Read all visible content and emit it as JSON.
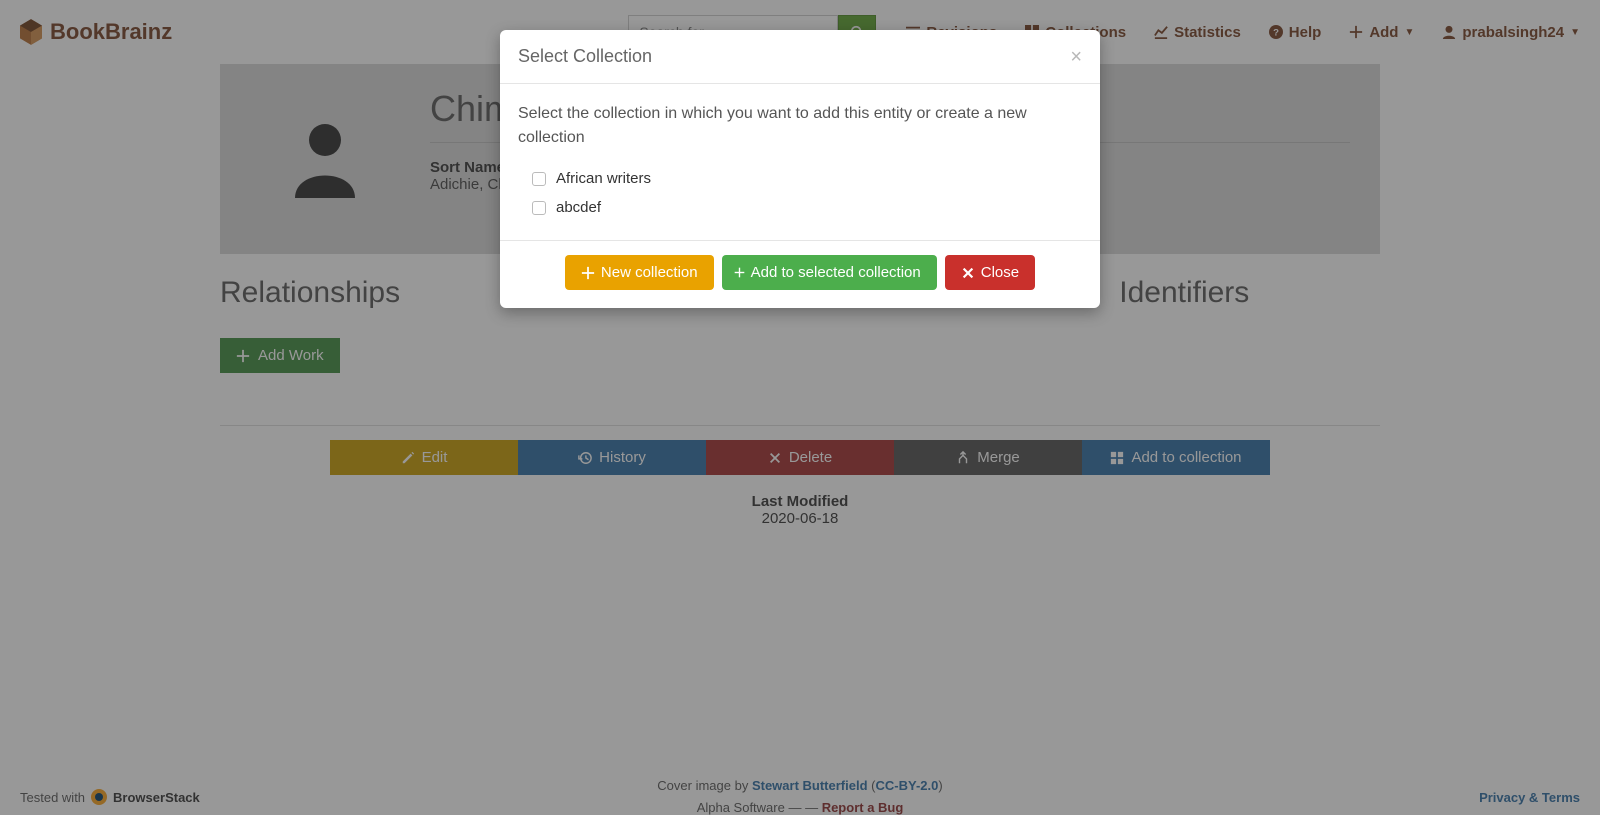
{
  "brand": "BookBrainz",
  "search": {
    "placeholder": "Search for..."
  },
  "nav": {
    "revisions": "Revisions",
    "collections": "Collections",
    "statistics": "Statistics",
    "help": "Help",
    "add": "Add",
    "user": "prabalsingh24"
  },
  "hero": {
    "title": "Chim",
    "sort_label": "Sort Name",
    "sort_value": "Adichie, Ch"
  },
  "sections": {
    "relationships": "Relationships",
    "identifiers": "Identifiers",
    "add_work": "Add Work"
  },
  "actions": {
    "edit": "Edit",
    "history": "History",
    "delete": "Delete",
    "merge": "Merge",
    "add_collection": "Add to collection"
  },
  "last_modified": {
    "label": "Last Modified",
    "date": "2020-06-18"
  },
  "footer": {
    "tested_with": "Tested with",
    "browserstack": "BrowserStack",
    "cover_prefix": "Cover image by ",
    "cover_author": "Stewart Butterfield",
    "cover_license": "CC-BY-2.0",
    "alpha": "Alpha Software — — ",
    "report_bug": "Report a Bug",
    "privacy": "Privacy & Terms"
  },
  "modal": {
    "title": "Select Collection",
    "prompt": "Select the collection in which you want to add this entity or create a new collection",
    "options": [
      "African writers",
      "abcdef"
    ],
    "btn_new": "New collection",
    "btn_add": "Add to selected collection",
    "btn_close": "Close"
  }
}
